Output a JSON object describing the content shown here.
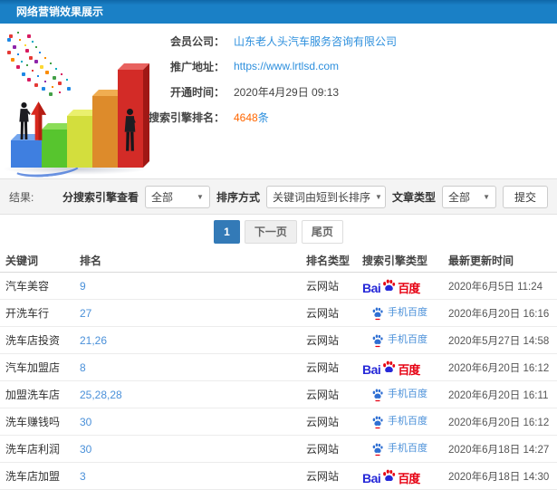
{
  "page": {
    "title": "网络营销效果展示"
  },
  "info": {
    "rows": [
      {
        "label": "会员公司：",
        "value": "山东老人头汽车服务咨询有限公司"
      },
      {
        "label": "推广地址：",
        "value": "https://www.lrtlsd.com"
      },
      {
        "label": "开通时间：",
        "value": "2020年4月29日 09:13"
      },
      {
        "label": "搜索引擎排名：",
        "value": "4648",
        "suffix": "条"
      }
    ]
  },
  "filters": {
    "results_label": "结果:",
    "engine": {
      "label": "分搜索引擎查看",
      "value": "全部"
    },
    "sort": {
      "label": "排序方式",
      "value": "关键词由短到长排序"
    },
    "article": {
      "label": "文章类型",
      "value": "全部"
    },
    "submit_label": "提交"
  },
  "pagination": {
    "current": "1",
    "next_label": "下一页",
    "last_label": "尾页"
  },
  "table": {
    "headers": [
      "关键词",
      "排名",
      "排名类型",
      "搜索引擎类型",
      "最新更新时间"
    ],
    "rows": [
      {
        "keyword": "汽车美容",
        "rank": "9",
        "rank_type": "云网站",
        "engine": "baidu",
        "time": "2020年6月5日 11:24"
      },
      {
        "keyword": "开洗车行",
        "rank": "27",
        "rank_type": "云网站",
        "engine": "mobile_baidu",
        "time": "2020年6月20日 16:16"
      },
      {
        "keyword": "洗车店投资",
        "rank": "21,26",
        "rank_type": "云网站",
        "engine": "mobile_baidu",
        "time": "2020年5月27日 14:58"
      },
      {
        "keyword": "汽车加盟店",
        "rank": "8",
        "rank_type": "云网站",
        "engine": "baidu",
        "time": "2020年6月20日 16:12"
      },
      {
        "keyword": "加盟洗车店",
        "rank": "25,28,28",
        "rank_type": "云网站",
        "engine": "mobile_baidu",
        "time": "2020年6月20日 16:11"
      },
      {
        "keyword": "洗车赚钱吗",
        "rank": "30",
        "rank_type": "云网站",
        "engine": "mobile_baidu",
        "time": "2020年6月20日 16:12"
      },
      {
        "keyword": "洗车店利润",
        "rank": "30",
        "rank_type": "云网站",
        "engine": "mobile_baidu",
        "time": "2020年6月18日 14:27"
      },
      {
        "keyword": "洗车店加盟",
        "rank": "3",
        "rank_type": "云网站",
        "engine": "baidu",
        "time": "2020年6月18日 14:30"
      }
    ]
  },
  "logos": {
    "baidu": {
      "prefix": "Bai",
      "suffix": "百度"
    },
    "mobile_baidu": {
      "label": "手机百度"
    }
  },
  "colors": {
    "header_blue": "#1a80c6",
    "link_blue": "#2d8fdd",
    "count_orange": "#ff6600",
    "active_page_blue": "#337ab7",
    "baidu_blue": "#2628d8",
    "baidu_red": "#e60012"
  }
}
